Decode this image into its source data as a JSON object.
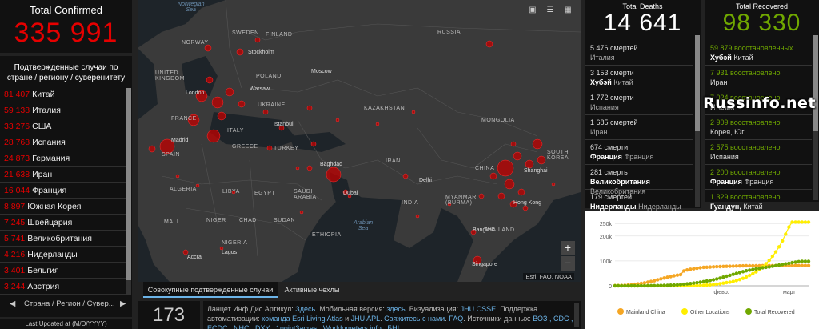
{
  "confirmed": {
    "title": "Total Confirmed",
    "total": "335 991",
    "list_header": "Подтвержденные случаи по стране / региону / суверенитету",
    "rows": [
      {
        "num": "81 407",
        "name": "Китай"
      },
      {
        "num": "59 138",
        "name": "Италия"
      },
      {
        "num": "33 276",
        "name": "США"
      },
      {
        "num": "28 768",
        "name": "Испания"
      },
      {
        "num": "24 873",
        "name": "Германия"
      },
      {
        "num": "21 638",
        "name": "Иран"
      },
      {
        "num": "16 044",
        "name": "Франция"
      },
      {
        "num": "8 897",
        "name": "Южная Корея"
      },
      {
        "num": "7 245",
        "name": "Швейцария"
      },
      {
        "num": "5 741",
        "name": "Великобритания"
      },
      {
        "num": "4 216",
        "name": "Нидерланды"
      },
      {
        "num": "3 401",
        "name": "Бельгия"
      },
      {
        "num": "3 244",
        "name": "Австрия"
      }
    ],
    "nav_label": "Страна / Регион / Сувер...",
    "nav_prev": "◀",
    "nav_next": "▶",
    "last_updated": "Last Updated at (M/D/YYYY)"
  },
  "map": {
    "labels": [
      {
        "t": "Norwegian\nSea",
        "kind": "sea"
      },
      {
        "t": "SWEDEN"
      },
      {
        "t": "FINLAND"
      },
      {
        "t": "NORWAY"
      },
      {
        "t": "RUSSIA"
      },
      {
        "t": "UNITED\nKINGDOM"
      },
      {
        "t": "POLAND"
      },
      {
        "t": "UKRAINE"
      },
      {
        "t": "KAZAKHSTAN"
      },
      {
        "t": "MONGOLIA"
      },
      {
        "t": "FRANCE"
      },
      {
        "t": "SPAIN"
      },
      {
        "t": "ITALY"
      },
      {
        "t": "GREECE"
      },
      {
        "t": "TURKEY"
      },
      {
        "t": "IRAN"
      },
      {
        "t": "CHINA"
      },
      {
        "t": "INDIA"
      },
      {
        "t": "ALGERIA"
      },
      {
        "t": "LIBYA"
      },
      {
        "t": "EGYPT"
      },
      {
        "t": "SAUDI\nARABIA"
      },
      {
        "t": "MALI"
      },
      {
        "t": "NIGER"
      },
      {
        "t": "CHAD"
      },
      {
        "t": "SUDAN"
      },
      {
        "t": "NIGERIA"
      },
      {
        "t": "ETHIOPIA"
      },
      {
        "t": "MYANMAR\n(BURMA)"
      },
      {
        "t": "SOUTH\nKOREA"
      },
      {
        "t": "THAILAND"
      },
      {
        "t": "Arabian\nSea",
        "kind": "sea"
      }
    ],
    "cities": [
      "Stockholm",
      "Moscow",
      "London",
      "Warsaw",
      "Istanbul",
      "Madrid",
      "Baghdad",
      "Dubai",
      "Delhi",
      "Shanghai",
      "Hong Kong",
      "Bangkok",
      "Singapore",
      "Accra",
      "Lagos"
    ],
    "attribution": "Esri, FAO, NOAA",
    "zoom_in": "+",
    "zoom_out": "−",
    "tools": [
      "▣",
      "☰",
      "▦"
    ]
  },
  "tabs": {
    "cumulative": "Совокупные подтвержденные случаи",
    "active": "Активные чехлы"
  },
  "countries_count": "173",
  "info": {
    "p1": "Ланцет Инф Дис Артикул: ",
    "l1": "Здесь",
    "p2": ". Мобильная версия: ",
    "l2": "здесь",
    "p3": ". Визуализация: ",
    "l3": "JHU CSSE",
    "p4": ". Поддержка автоматизации: ",
    "l4": "команда Esri Living Atlas",
    "p5": " и ",
    "l5": "JHU APL",
    "p6": ". ",
    "l6": "Свяжитесь с нами",
    "p7": ". ",
    "l7": "FAQ",
    "p8": ". Источники данных: ",
    "l8": "ВОЗ , CDC , ECDC , NHC , DXY , 1point3acres , Worldometers.info , БНІ"
  },
  "deaths": {
    "title": "Total Deaths",
    "total": "14 641",
    "rows": [
      {
        "l1": "5 476 смертей",
        "l2": "Италия"
      },
      {
        "l1": "3 153 смерти",
        "l2b": "Хубэй",
        "l2": "Китай"
      },
      {
        "l1": "1 772 смерти",
        "l2": "Испания"
      },
      {
        "l1": "1 685 смертей",
        "l2": "Иран"
      },
      {
        "l1": "674 смерти",
        "l2b": "Франция",
        "l2": "Франция"
      },
      {
        "l1": "281 смерть",
        "l2b": "Великобритания",
        "l2": "Великобритания"
      },
      {
        "l1": "179 смертей",
        "l2b": "Нидерланды",
        "l2": "Нидерланды"
      }
    ]
  },
  "recovered": {
    "title": "Total Recovered",
    "total": "98 330",
    "rows": [
      {
        "l1": "59 879 восстановленных",
        "l2b": "Хубэй",
        "l2": "Китай"
      },
      {
        "l1": "7 931 восстановлено",
        "l2": "Иран"
      },
      {
        "l1": "7 024 восстановлено",
        "l2": "Италия"
      },
      {
        "l1": "2 909 восстановлено",
        "l2": "Корея, Юг"
      },
      {
        "l1": "2 575 восстановлено",
        "l2": "Испания"
      },
      {
        "l1": "2 200 восстановлено",
        "l2b": "Франция",
        "l2": "Франция"
      },
      {
        "l1": "1 329 восстановлено",
        "l2b": "Гуандун,",
        "l2": "Китай"
      }
    ]
  },
  "chart_data": {
    "type": "line",
    "y_ticks": [
      "0",
      "100k",
      "200k",
      "250k"
    ],
    "ylim": [
      0,
      270000
    ],
    "x_labels": [
      "февр.",
      "март"
    ],
    "x_points": 60,
    "series": [
      {
        "name": "Mainland China",
        "color": "#f5a623",
        "values": [
          500,
          900,
          1300,
          2000,
          2800,
          4500,
          6000,
          7700,
          9700,
          11800,
          14400,
          17200,
          20400,
          24500,
          28000,
          31200,
          34500,
          37100,
          40200,
          42700,
          44600,
          59800,
          63800,
          66500,
          68500,
          70500,
          72400,
          74200,
          74600,
          75100,
          76200,
          76800,
          77200,
          77700,
          78100,
          78500,
          78800,
          79300,
          79800,
          80100,
          80300,
          80500,
          80700,
          80700,
          80800,
          80900,
          81000,
          81000,
          81100,
          81100,
          81200,
          81200,
          81300,
          81300,
          81300,
          81400,
          81400,
          81400,
          81400,
          81400
        ]
      },
      {
        "name": "Other Locations",
        "color": "#ffee00",
        "values": [
          0,
          0,
          0,
          10,
          20,
          30,
          50,
          60,
          80,
          100,
          120,
          150,
          160,
          180,
          200,
          230,
          260,
          300,
          330,
          380,
          420,
          450,
          500,
          600,
          800,
          1100,
          1500,
          2100,
          2900,
          3900,
          5100,
          6600,
          8500,
          10600,
          12700,
          14800,
          17500,
          21100,
          25200,
          29800,
          35400,
          41900,
          48700,
          56000,
          65200,
          76100,
          88600,
          102600,
          118600,
          136400,
          156500,
          180400,
          207800,
          236000,
          256000,
          256000,
          256000,
          256000,
          256000,
          256000
        ]
      },
      {
        "name": "Total Recovered",
        "color": "#70a800",
        "values": [
          0,
          0,
          0,
          0,
          10,
          20,
          40,
          60,
          100,
          200,
          300,
          500,
          700,
          900,
          1200,
          1600,
          2000,
          2500,
          3200,
          4000,
          5000,
          6200,
          7600,
          9100,
          10800,
          12600,
          14600,
          16800,
          19000,
          21500,
          24000,
          27500,
          31000,
          34700,
          38500,
          42100,
          45900,
          49700,
          53300,
          56800,
          60300,
          62900,
          66000,
          68300,
          70100,
          72600,
          74300,
          76000,
          78300,
          80900,
          83200,
          85700,
          88000,
          90400,
          92800,
          95200,
          97200,
          98330,
          98330,
          98330
        ]
      }
    ],
    "watermark": "Russinfo.net"
  }
}
